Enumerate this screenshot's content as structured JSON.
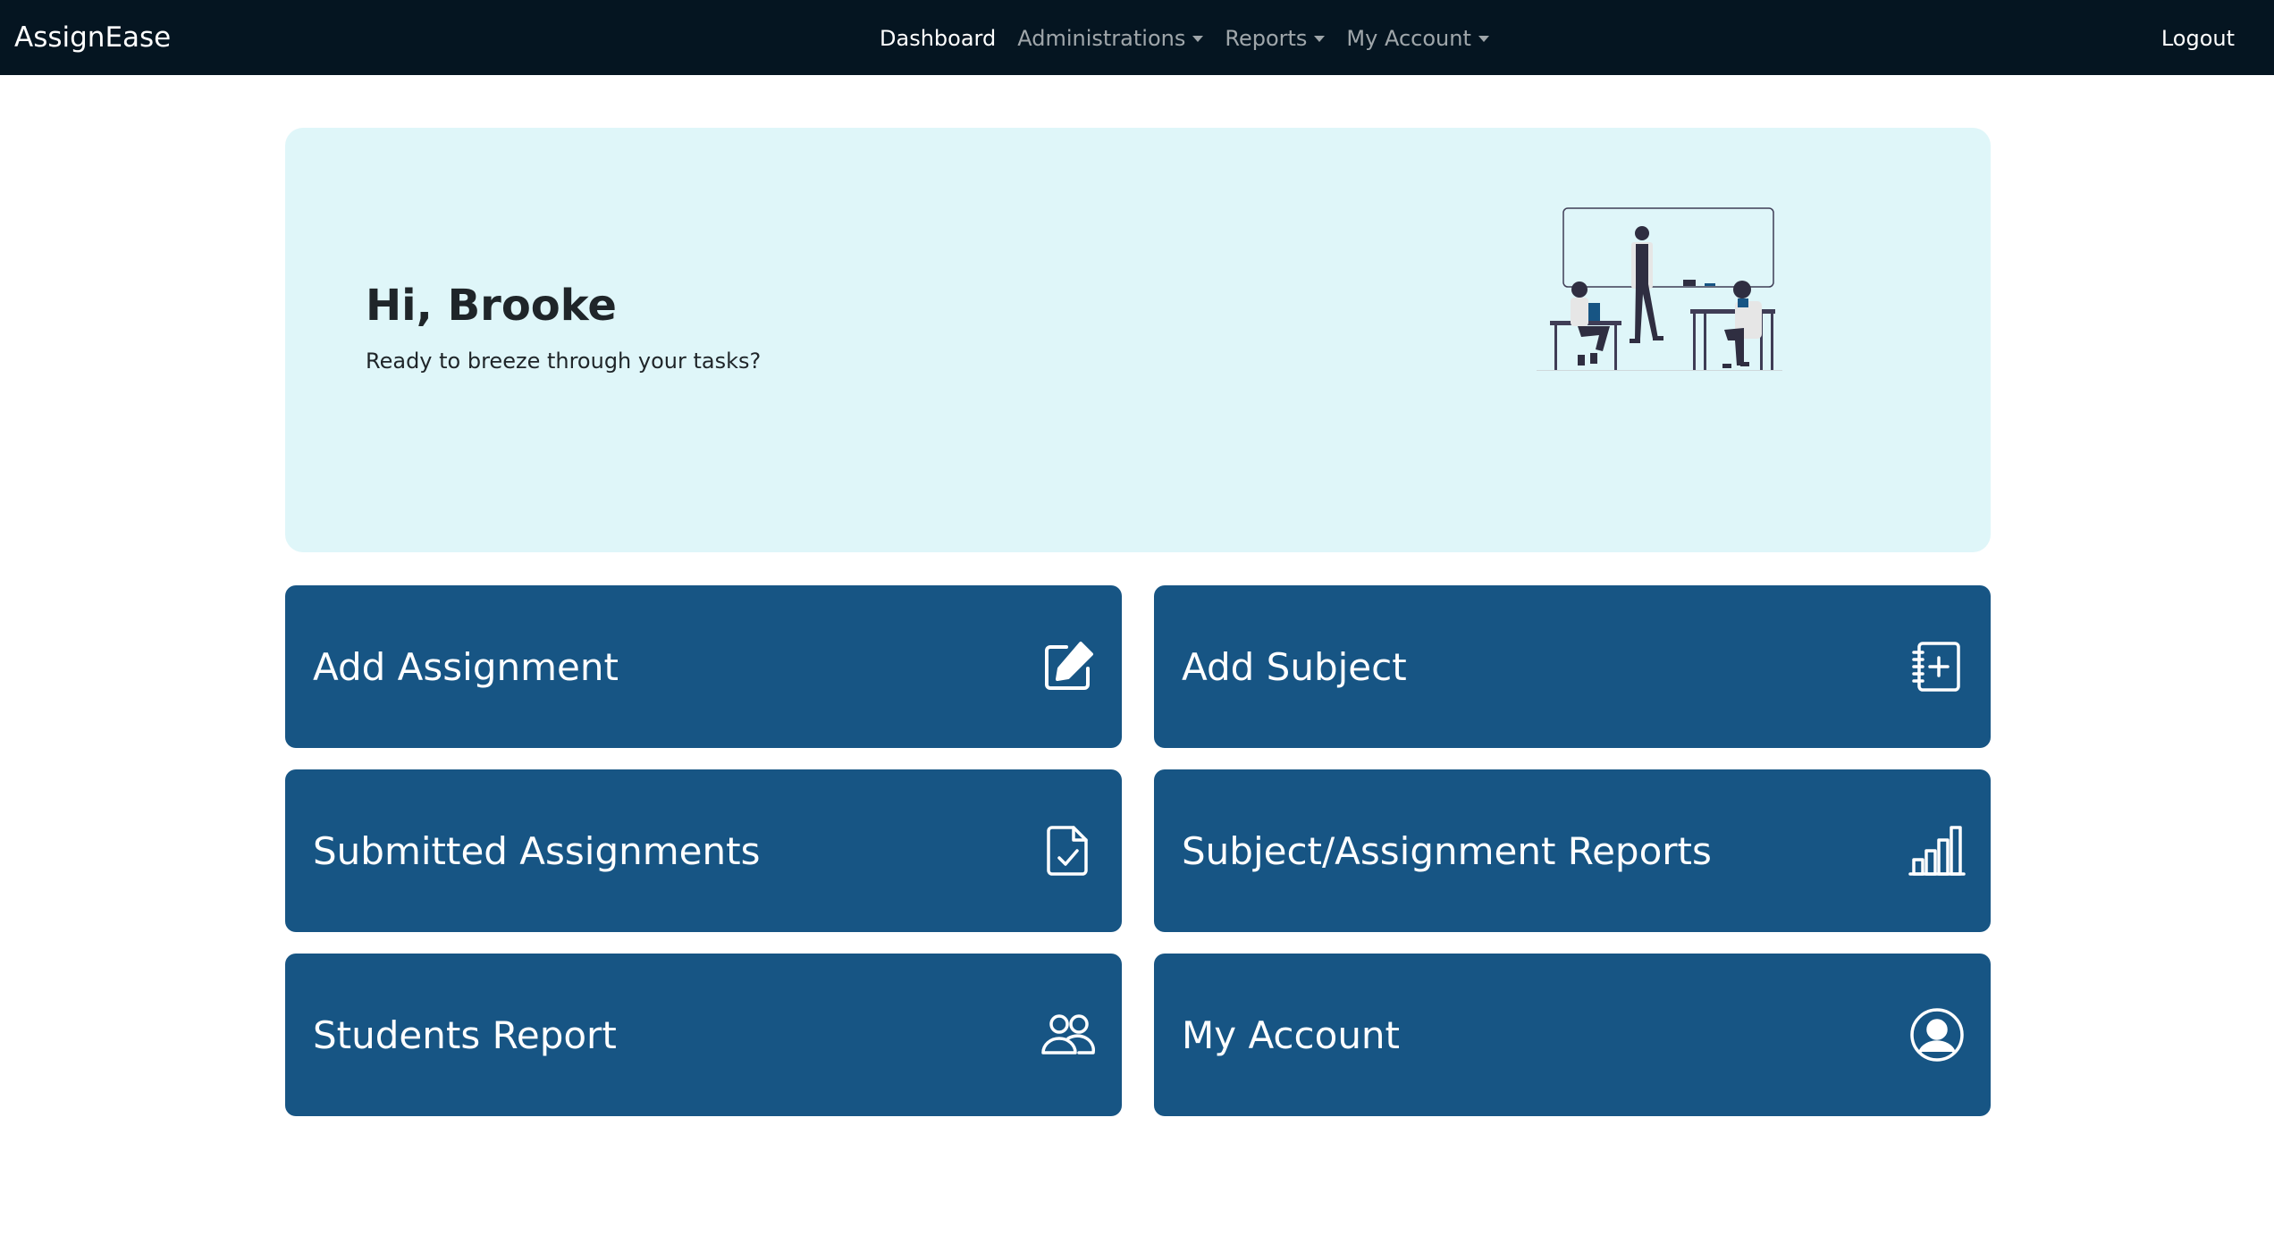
{
  "app": {
    "brand": "AssignEase"
  },
  "nav": {
    "items": [
      {
        "label": "Dashboard",
        "active": true,
        "dropdown": false
      },
      {
        "label": "Administrations",
        "active": false,
        "dropdown": true
      },
      {
        "label": "Reports",
        "active": false,
        "dropdown": true
      },
      {
        "label": "My Account",
        "active": false,
        "dropdown": true
      }
    ],
    "logout": "Logout"
  },
  "hero": {
    "greeting": "Hi, Brooke",
    "subtitle": "Ready to breeze through your tasks?",
    "illustration": "classroom-illustration"
  },
  "cards": [
    {
      "label": "Add Assignment",
      "icon": "edit-square-icon"
    },
    {
      "label": "Add Subject",
      "icon": "notebook-plus-icon"
    },
    {
      "label": "Submitted Assignments",
      "icon": "document-check-icon"
    },
    {
      "label": "Subject/Assignment Reports",
      "icon": "bar-chart-icon"
    },
    {
      "label": "Students Report",
      "icon": "people-icon"
    },
    {
      "label": "My Account",
      "icon": "user-circle-icon"
    }
  ],
  "colors": {
    "navbar": "#051521",
    "hero_bg": "#dff6f9",
    "card_bg": "#175584",
    "text_dark": "#1f2529"
  }
}
